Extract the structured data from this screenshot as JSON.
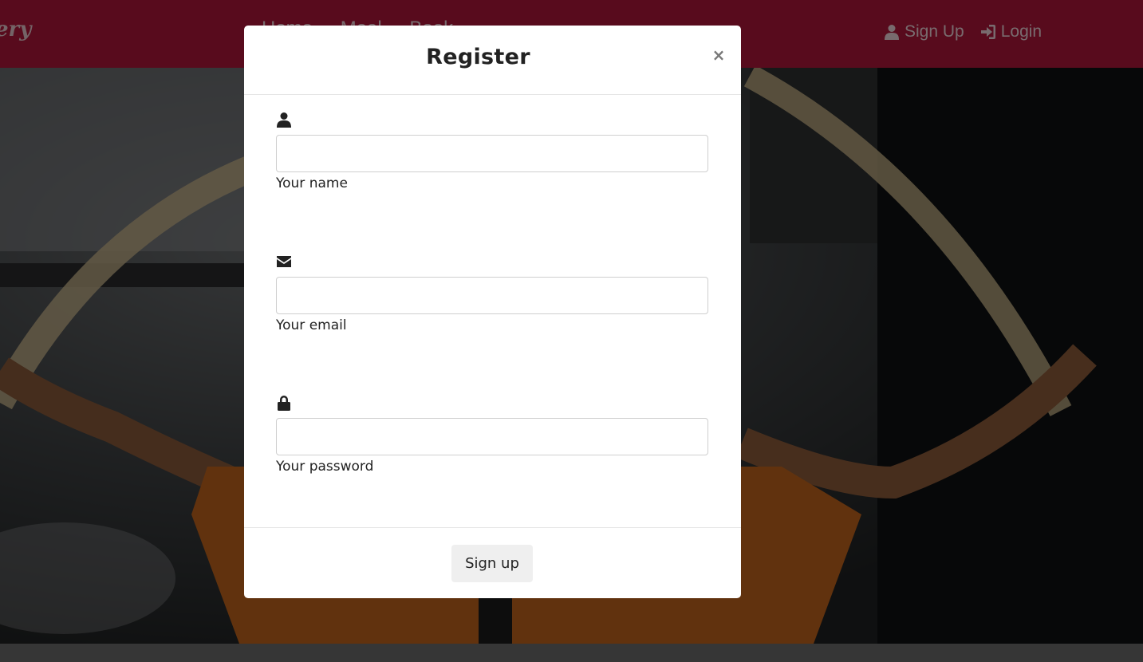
{
  "navbar": {
    "brand": "ery",
    "links": [
      "Home",
      "Meal",
      "Book"
    ],
    "signup_label": "Sign Up",
    "login_label": "Login",
    "color": "#b0163a"
  },
  "modal": {
    "title": "Register",
    "close_symbol": "×",
    "fields": {
      "name": {
        "icon": "user-icon",
        "label": "Your name",
        "value": ""
      },
      "email": {
        "icon": "envelope-icon",
        "label": "Your email",
        "value": ""
      },
      "password": {
        "icon": "lock-icon",
        "label": "Your password",
        "value": ""
      }
    },
    "submit_label": "Sign up"
  }
}
